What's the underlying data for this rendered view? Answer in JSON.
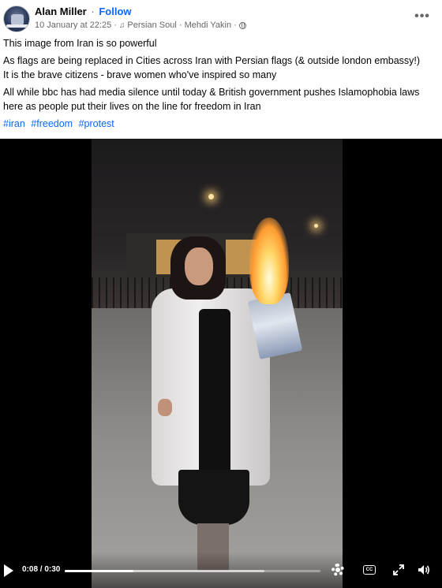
{
  "post": {
    "author": "Alan Miller",
    "separator": "·",
    "follow_label": "Follow",
    "timestamp": "10 January at 22:25",
    "meta_separator_1": "·",
    "audio_track": "Persian Soul · Mehdi Yakin",
    "meta_separator_2": "·",
    "more_label": "•••",
    "paragraphs": [
      "This image from Iran is so powerful",
      "As flags are being replaced in Cities across Iran with Persian flags (& outside london embassy!)",
      "It is the brave citizens - brave women who've inspired so many",
      "All while bbc has had media silence until today & British government pushes Islamophobia laws here as people put their lives on the line for freedom in Iran"
    ],
    "hashtags": [
      "#iran",
      "#freedom",
      "#protest"
    ]
  },
  "video": {
    "time": "0:08 / 0:30",
    "progress_fraction": 0.27,
    "buffered_fraction": 0.78,
    "cc_label": "CC"
  },
  "icons": {
    "audio": "music-note-icon",
    "privacy": "globe-icon",
    "more": "more-options-icon",
    "play": "play-icon",
    "settings": "gear-icon",
    "captions": "cc-icon",
    "fullscreen": "fullscreen-icon",
    "volume": "volume-icon"
  }
}
